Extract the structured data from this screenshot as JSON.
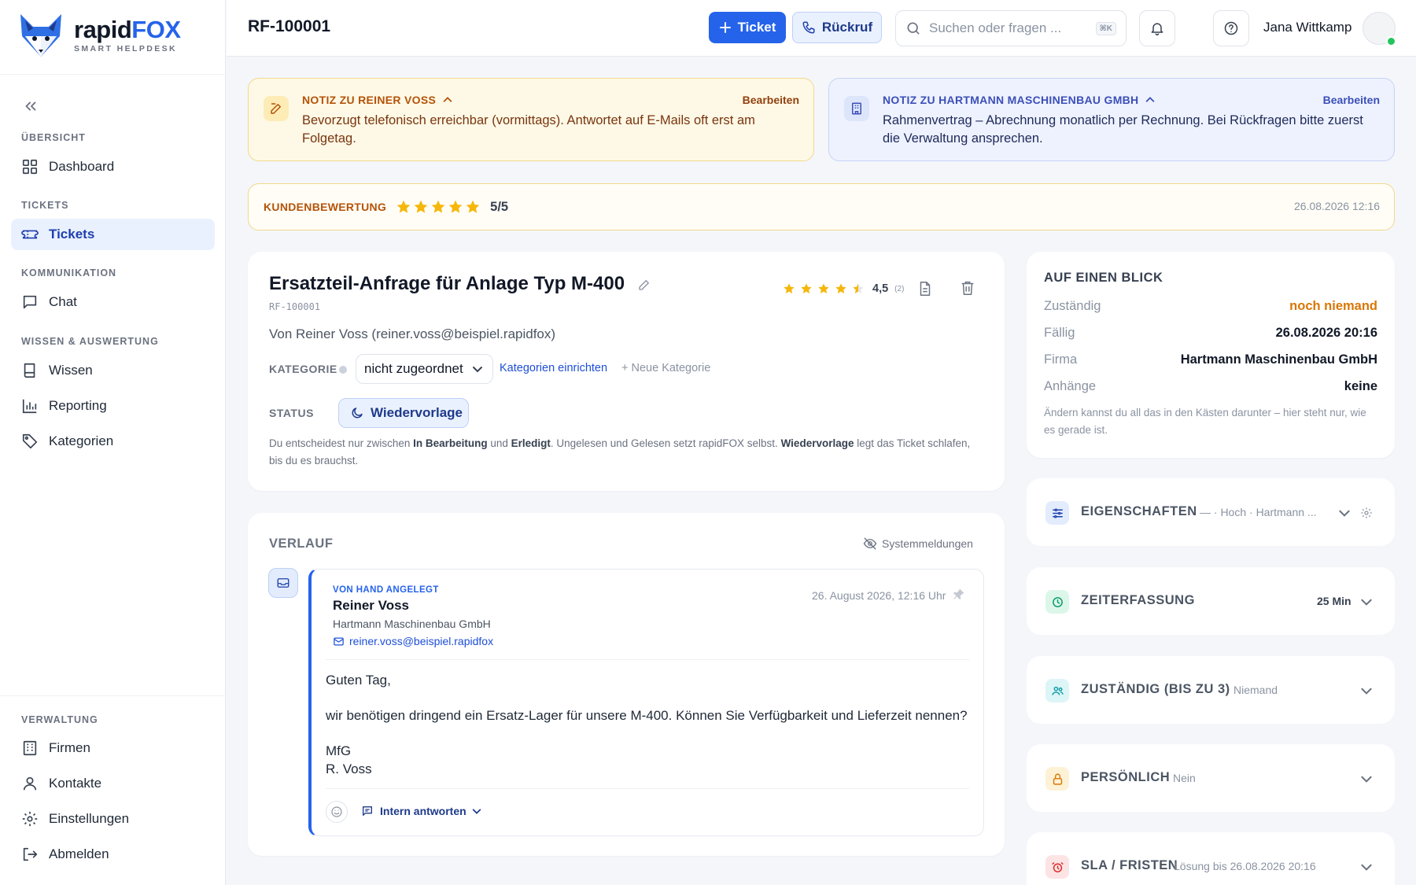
{
  "brand": {
    "name_a": "rapid",
    "name_b": "FOX",
    "tagline": "SMART HELPDESK"
  },
  "sidebar": {
    "sections": {
      "overview": "ÜBERSICHT",
      "tickets": "TICKETS",
      "communication": "KOMMUNIKATION",
      "knowledge": "WISSEN & AUSWERTUNG",
      "admin": "VERWALTUNG"
    },
    "items": {
      "dashboard": "Dashboard",
      "tickets": "Tickets",
      "chat": "Chat",
      "wissen": "Wissen",
      "reporting": "Reporting",
      "kategorien": "Kategorien",
      "firmen": "Firmen",
      "kontakte": "Kontakte",
      "einstellungen": "Einstellungen",
      "abmelden": "Abmelden"
    },
    "active": "tickets"
  },
  "header": {
    "ticket_id": "RF-100001",
    "new_ticket_label": "Ticket",
    "callback_label": "Rückruf",
    "search_placeholder": "Suchen oder fragen ...",
    "search_shortcut": "⌘K",
    "user_name": "Jana Wittkamp"
  },
  "notes": {
    "contact": {
      "title": "NOTIZ ZU REINER VOSS",
      "edit": "Bearbeiten",
      "text": "Bevorzugt telefonisch erreichbar (vormittags). Antwortet auf E-Mails oft erst am Folgetag."
    },
    "company": {
      "title": "NOTIZ ZU HARTMANN MASCHINENBAU GMBH",
      "edit": "Bearbeiten",
      "text": "Rahmenvertrag – Abrechnung monatlich per Rechnung. Bei Rückfragen bitte zuerst die Verwaltung ansprechen."
    }
  },
  "customer_rating": {
    "label": "KUNDENBEWERTUNG",
    "stars": 5,
    "max": 5,
    "score_text": "5/5",
    "date": "26.08.2026 12:16"
  },
  "ticket": {
    "title": "Ersatzteil-Anfrage für Anlage Typ M-400",
    "id": "RF-100001",
    "rating_stars": 4.5,
    "rating_value": "4,5",
    "rating_count": "(2)",
    "from": "Von Reiner Voss (reiner.voss@beispiel.rapidfox)",
    "category_label": "KATEGORIE",
    "category_value": "nicht zugeordnet",
    "category_setup_link": "Kategorien einrichten",
    "category_new": "+ Neue Kategorie",
    "status_label": "STATUS",
    "status_value": "Wiedervorlage",
    "help": {
      "p1": "Du entscheidest nur zwischen ",
      "b1": "In Bearbeitung",
      "p2": " und ",
      "b2": "Erledigt",
      "p3": ". Ungelesen und Gelesen setzt rapidFOX selbst. ",
      "b3": "Wiedervorlage",
      "p4": " legt das Ticket schlafen, bis du es brauchst."
    }
  },
  "history": {
    "title": "VERLAUF",
    "system_toggle": "Systemmeldungen",
    "message": {
      "tag": "VON HAND ANGELEGT",
      "sender": "Reiner Voss",
      "company": "Hartmann Maschinenbau GmbH",
      "email": "reiner.voss@beispiel.rapidfox",
      "date": "26. August 2026, 12:16 Uhr",
      "body": [
        "Guten Tag,",
        "",
        "wir benötigen dringend ein Ersatz-Lager für unsere M-400. Können Sie Verfügbarkeit und Lieferzeit nennen?",
        "",
        "MfG",
        "R. Voss"
      ],
      "reply_label": "Intern antworten"
    }
  },
  "glance": {
    "title": "AUF EINEN BLICK",
    "rows": [
      {
        "key": "Zuständig",
        "value": "noch niemand"
      },
      {
        "key": "Fällig",
        "value": "26.08.2026 20:16"
      },
      {
        "key": "Firma",
        "value": "Hartmann Maschinenbau GmbH"
      },
      {
        "key": "Anhänge",
        "value": "keine"
      }
    ],
    "note": "Ändern kannst du all das in den Kästen darunter – hier steht nur, wie es gerade ist."
  },
  "panels": {
    "properties": {
      "title": "EIGENSCHAFTEN",
      "summary": "— · Hoch · Hartmann ..."
    },
    "time": {
      "title": "ZEITERFASSUNG",
      "summary": "25 Min"
    },
    "assignee": {
      "title": "ZUSTÄNDIG (BIS ZU 3)",
      "summary": "Niemand"
    },
    "personal": {
      "title": "PERSÖNLICH",
      "summary": "Nein"
    },
    "sla": {
      "title": "SLA / FRISTEN",
      "summary": "Lösung bis 26.08.2026 20:16"
    }
  },
  "colors": {
    "accent": "#2563eb",
    "note_yellow": "#fef9e6",
    "note_blue": "#eef2fe",
    "star": "#f5b70c",
    "warn": "#d97706"
  }
}
